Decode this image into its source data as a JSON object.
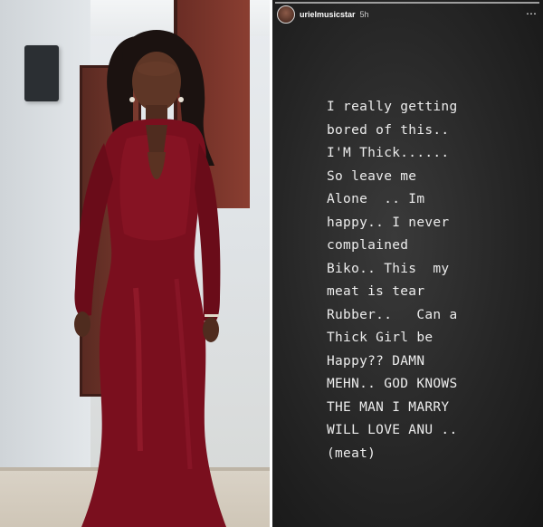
{
  "story_header": {
    "username": "urielmusicstar",
    "time": "5h"
  },
  "story_lines": [
    "I really getting",
    "bored of this..",
    "I'M Thick......",
    "So leave me",
    "Alone  .. Im",
    "happy.. I never",
    "complained",
    "Biko.. This  my",
    "meat is tear",
    "Rubber..   Can a",
    "Thick Girl be",
    "Happy?? DAMN",
    "MEHN.. GOD KNOWS",
    "THE MAN I MARRY",
    "WILL LOVE ANU ..",
    "(meat)"
  ],
  "colors": {
    "dress": "#7a0f1e",
    "story_bg": "#262626",
    "story_text": "#ececec"
  },
  "icons": {
    "avatar": "profile-avatar",
    "more": "more-dots-icon"
  }
}
